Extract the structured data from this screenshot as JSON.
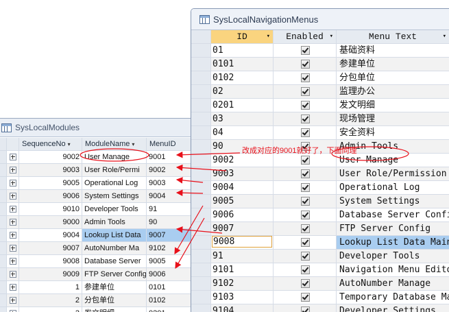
{
  "left_window": {
    "title": "SysLocalModules",
    "columns": [
      "SequenceNo",
      "ModuleName",
      "MenuID"
    ],
    "rows": [
      {
        "seq": "9002",
        "name": "User Manage",
        "menu_id": "9001"
      },
      {
        "seq": "9003",
        "name": "User Role/Permi",
        "menu_id": "9002"
      },
      {
        "seq": "9005",
        "name": "Operational Log",
        "menu_id": "9003"
      },
      {
        "seq": "9006",
        "name": "System Settings",
        "menu_id": "9004"
      },
      {
        "seq": "9010",
        "name": "Developer Tools",
        "menu_id": "91"
      },
      {
        "seq": "9000",
        "name": "Admin Tools",
        "menu_id": "90"
      },
      {
        "seq": "9004",
        "name": "Lookup List Data",
        "menu_id": "9007"
      },
      {
        "seq": "9007",
        "name": "AutoNumber Ma",
        "menu_id": "9102"
      },
      {
        "seq": "9008",
        "name": "Database Server",
        "menu_id": "9005"
      },
      {
        "seq": "9009",
        "name": "FTP Server Config",
        "menu_id": "9006"
      },
      {
        "seq": "1",
        "name": "参建单位",
        "menu_id": "0101"
      },
      {
        "seq": "2",
        "name": "分包单位",
        "menu_id": "0102"
      },
      {
        "seq": "3",
        "name": "发文明细",
        "menu_id": "0201"
      }
    ]
  },
  "right_window": {
    "title": "SysLocalNavigationMenus",
    "columns": [
      "ID",
      "Enabled",
      "Menu Text"
    ],
    "rows": [
      {
        "id": "01",
        "text": "基础资料"
      },
      {
        "id": "0101",
        "text": "参建单位"
      },
      {
        "id": "0102",
        "text": "分包单位"
      },
      {
        "id": "02",
        "text": "监理办公"
      },
      {
        "id": "0201",
        "text": "发文明细"
      },
      {
        "id": "03",
        "text": "现场管理"
      },
      {
        "id": "04",
        "text": "安全资料"
      },
      {
        "id": "90",
        "text": "Admin Tools"
      },
      {
        "id": "9002",
        "text": "User Manage"
      },
      {
        "id": "9003",
        "text": "User Role/Permission"
      },
      {
        "id": "9004",
        "text": "Operational Log"
      },
      {
        "id": "9005",
        "text": "System Settings"
      },
      {
        "id": "9006",
        "text": "Database Server Config"
      },
      {
        "id": "9007",
        "text": "FTP Server Config"
      },
      {
        "id": "9008",
        "text": "Lookup List Data Maint"
      },
      {
        "id": "91",
        "text": "Developer Tools"
      },
      {
        "id": "9101",
        "text": "Navigation Menu Editor"
      },
      {
        "id": "9102",
        "text": "AutoNumber Manage"
      },
      {
        "id": "9103",
        "text": "Temporary Database Maint"
      },
      {
        "id": "9104",
        "text": "Developer Settings"
      }
    ],
    "editing_row_index": 14
  },
  "annotation": {
    "note": "改成对应的9001就好了，下面同理",
    "color": "#e8101a"
  },
  "colors": {
    "selection": "#a9cdf0",
    "sorted_header": "#fad47f",
    "header": "#e6ebf1"
  }
}
